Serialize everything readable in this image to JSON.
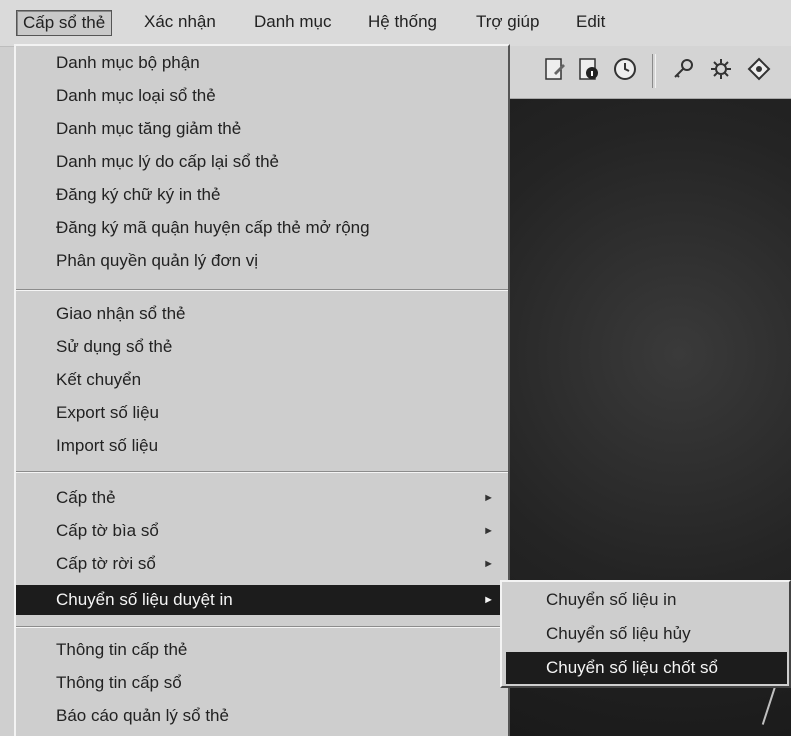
{
  "menubar": {
    "items": [
      {
        "label": "Cấp sổ thẻ"
      },
      {
        "label": "Xác nhận"
      },
      {
        "label": "Danh mục"
      },
      {
        "label": "Hệ thống"
      },
      {
        "label": "Trợ giúp"
      },
      {
        "label": "Edit"
      }
    ]
  },
  "toolbar": {
    "icons": [
      "document-edit-icon",
      "document-info-icon",
      "clock-icon",
      "key-icon",
      "settings-gear-icon",
      "navigation-icon"
    ]
  },
  "dropdown": {
    "group1": [
      {
        "label": "Danh mục bộ phận"
      },
      {
        "label": "Danh mục loại sổ thẻ"
      },
      {
        "label": "Danh mục tăng giảm thẻ"
      },
      {
        "label": "Danh mục lý do cấp lại sổ thẻ"
      },
      {
        "label": "Đăng ký chữ ký in thẻ"
      },
      {
        "label": "Đăng ký mã quận huyện cấp thẻ mở rộng"
      },
      {
        "label": "Phân quyền quản lý đơn vị"
      }
    ],
    "group2": [
      {
        "label": "Giao nhận sổ thẻ"
      },
      {
        "label": "Sử dụng sổ thẻ"
      },
      {
        "label": "Kết chuyển"
      },
      {
        "label": "Export số liệu"
      },
      {
        "label": "Import số liệu"
      }
    ],
    "group3": [
      {
        "label": "Cấp thẻ",
        "arrow": "►"
      },
      {
        "label": "Cấp tờ bìa sổ",
        "arrow": "►"
      },
      {
        "label": "Cấp tờ rời sổ",
        "arrow": "►"
      },
      {
        "label": "Chuyển số liệu duyệt in",
        "arrow": "►"
      }
    ],
    "group4": [
      {
        "label": "Thông tin cấp thẻ"
      },
      {
        "label": "Thông tin cấp sổ"
      },
      {
        "label": "Báo cáo quản lý sổ thẻ"
      }
    ]
  },
  "submenu": {
    "items": [
      {
        "label": "Chuyển số liệu in"
      },
      {
        "label": "Chuyển số liệu hủy"
      },
      {
        "label": "Chuyển số liệu chốt sổ"
      }
    ]
  }
}
